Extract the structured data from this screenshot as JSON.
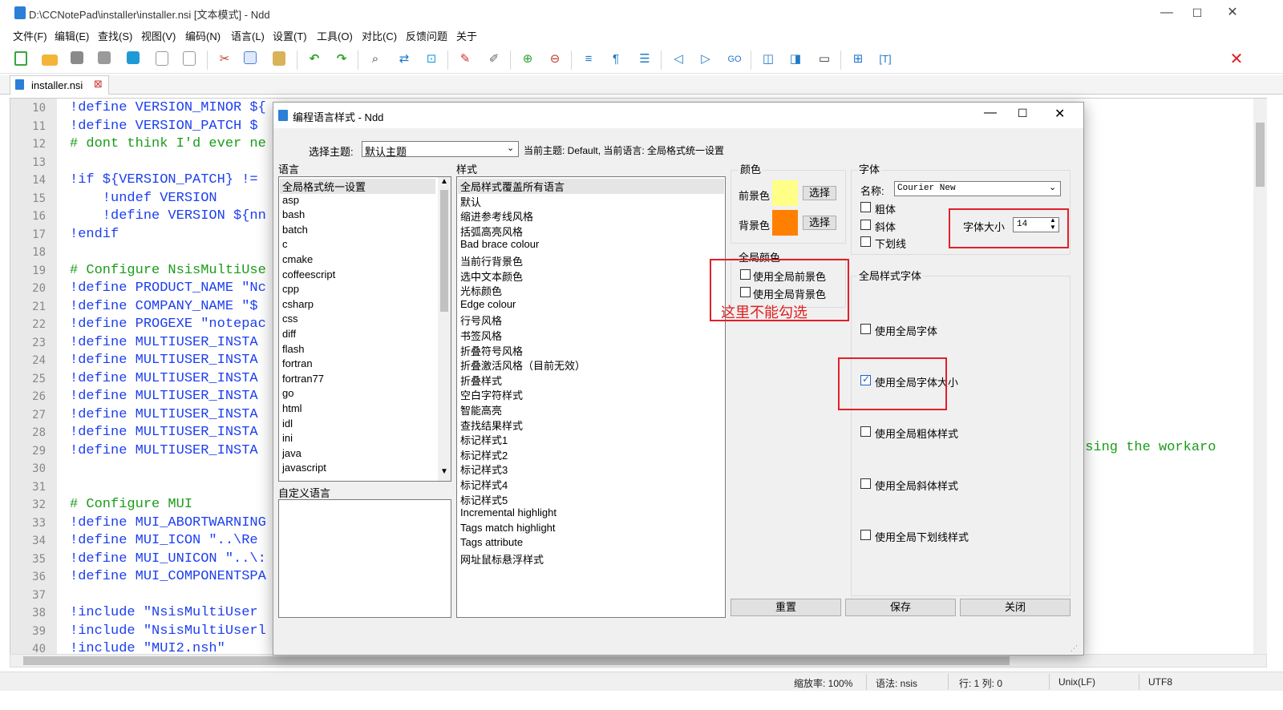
{
  "window": {
    "title": "D:\\CCNotePad\\installer\\installer.nsi [文本模式] - Ndd",
    "min": "—",
    "max": "☐",
    "close": "✕"
  },
  "menu": [
    "文件(F)",
    "编辑(E)",
    "查找(S)",
    "视图(V)",
    "编码(N)",
    "语言(L)",
    "设置(T)",
    "工具(O)",
    "对比(C)",
    "反馈问题",
    "关于"
  ],
  "toolbar_icons": [
    "new-file-icon",
    "open-file-icon",
    "save-icon",
    "save-all-icon",
    "reload-icon",
    "close-file-icon",
    "close-all-icon",
    "cut-icon",
    "copy-icon",
    "paste-icon",
    "undo-icon",
    "redo-icon",
    "find-icon",
    "replace-icon",
    "bookmark-icon",
    "mark-icon",
    "clear-mark-icon",
    "zoom-in-icon",
    "zoom-out-icon",
    "word-wrap-icon",
    "show-symbols-icon",
    "indent-guide-icon",
    "prev-icon",
    "next-icon",
    "goto-icon",
    "compare-icon",
    "bin-compare-icon",
    "monitor-icon",
    "tree-icon",
    "text-icon"
  ],
  "toolbar_close": "✕",
  "tab": {
    "label": "installer.nsi",
    "close": "⊠"
  },
  "editor": {
    "lines": [
      {
        "n": "10",
        "code": "!define VERSION_MINOR ${"
      },
      {
        "n": "11",
        "code": "!define VERSION_PATCH $"
      },
      {
        "n": "12",
        "code": "# dont think I'd ever ne"
      },
      {
        "n": "13",
        "code": ""
      },
      {
        "n": "14",
        "code": "!if ${VERSION_PATCH} !="
      },
      {
        "n": "15",
        "code": "    !undef VERSION"
      },
      {
        "n": "16",
        "code": "    !define VERSION ${nn"
      },
      {
        "n": "17",
        "code": "!endif"
      },
      {
        "n": "18",
        "code": ""
      },
      {
        "n": "19",
        "code": "# Configure NsisMultiUse"
      },
      {
        "n": "20",
        "code": "!define PRODUCT_NAME \"Nc"
      },
      {
        "n": "21",
        "code": "!define COMPANY_NAME \"$"
      },
      {
        "n": "22",
        "code": "!define PROGEXE \"notepac"
      },
      {
        "n": "23",
        "code": "!define MULTIUSER_INSTA"
      },
      {
        "n": "24",
        "code": "!define MULTIUSER_INSTA"
      },
      {
        "n": "25",
        "code": "!define MULTIUSER_INSTA"
      },
      {
        "n": "26",
        "code": "!define MULTIUSER_INSTA"
      },
      {
        "n": "27",
        "code": "!define MULTIUSER_INSTA"
      },
      {
        "n": "28",
        "code": "!define MULTIUSER_INSTA"
      },
      {
        "n": "29",
        "code": "!define MULTIUSER_INSTA"
      },
      {
        "n": "30",
        "code": ""
      },
      {
        "n": "31",
        "code": ""
      },
      {
        "n": "32",
        "code": "# Configure MUI"
      },
      {
        "n": "33",
        "code": "!define MUI_ABORTWARNING"
      },
      {
        "n": "34",
        "code": "!define MUI_ICON \"..\\Re"
      },
      {
        "n": "35",
        "code": "!define MUI_UNICON \"..\\:"
      },
      {
        "n": "36",
        "code": "!define MUI_COMPONENTSPA"
      },
      {
        "n": "37",
        "code": ""
      },
      {
        "n": "38",
        "code": "!include \"NsisMultiUser"
      },
      {
        "n": "39",
        "code": "!include \"NsisMultiUserl"
      },
      {
        "n": "40",
        "code": "!include \"MUI2.nsh\""
      }
    ],
    "right_fragment": "using the workaro"
  },
  "status": {
    "zoom": "缩放率: 100%",
    "lang": "语法: nsis",
    "pos": "行: 1 列: 0",
    "eol": "Unix(LF)",
    "enc": "UTF8"
  },
  "dialog": {
    "title": "编程语言样式 - Ndd",
    "theme_label": "选择主题:",
    "theme_value": "默认主题",
    "current": "当前主题: Default, 当前语言: 全局格式统一设置",
    "lang_header": "语言",
    "languages": [
      "全局格式统一设置",
      "asp",
      "bash",
      "batch",
      "c",
      "cmake",
      "coffeescript",
      "cpp",
      "csharp",
      "css",
      "diff",
      "flash",
      "fortran",
      "fortran77",
      "go",
      "html",
      "idl",
      "ini",
      "java",
      "javascript"
    ],
    "custom_lang": "自定义语言",
    "style_header": "样式",
    "styles": [
      "全局样式覆盖所有语言",
      "默认",
      "缩进参考线风格",
      "括弧高亮风格",
      "Bad brace colour",
      "当前行背景色",
      "选中文本颜色",
      "光标颜色",
      "Edge colour",
      "行号风格",
      "书签风格",
      "折叠符号风格",
      "折叠激活风格（目前无效）",
      "折叠样式",
      "空白字符样式",
      "智能高亮",
      "查找结果样式",
      "标记样式1",
      "标记样式2",
      "标记样式3",
      "标记样式4",
      "标记样式5",
      "Incremental highlight",
      "Tags match highlight",
      "Tags attribute",
      "网址鼠标悬浮样式"
    ],
    "color_group": "颜色",
    "fg_label": "前景色",
    "fg_color": "#ffff88",
    "bg_label": "背景色",
    "bg_color": "#ff8000",
    "choose": "选择",
    "global_color_group": "全局颜色",
    "use_global_fg": "使用全局前景色",
    "use_global_bg": "使用全局背景色",
    "annotation": "这里不能勾选",
    "font_group": "字体",
    "name_label": "名称:",
    "font_name": "Courier New",
    "bold": "粗体",
    "italic": "斜体",
    "underline": "下划线",
    "size_label": "字体大小",
    "size_value": "14",
    "global_font_group": "全局样式字体",
    "use_global_font": "使用全局字体",
    "use_global_size": "使用全局字体大小",
    "use_global_bold": "使用全局粗体样式",
    "use_global_italic": "使用全局斜体样式",
    "use_global_underline": "使用全局下划线样式",
    "btn_reset": "重置",
    "btn_save": "保存",
    "btn_close": "关闭"
  }
}
